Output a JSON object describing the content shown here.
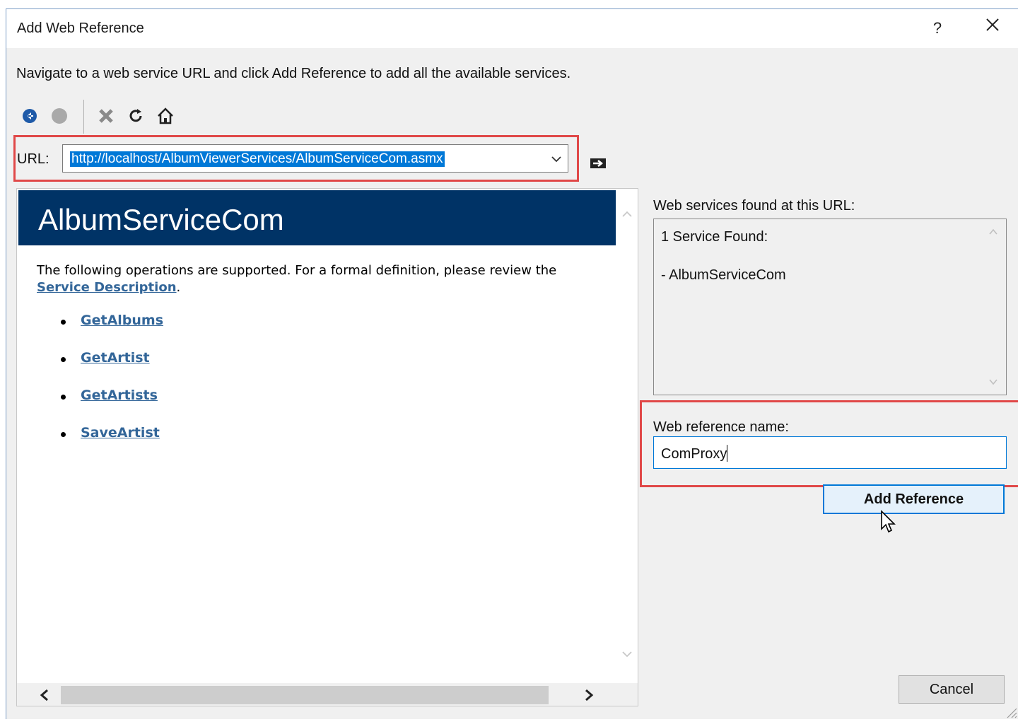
{
  "window": {
    "title": "Add Web Reference",
    "help_label": "?",
    "instruction": "Navigate to a web service URL and click Add Reference to add all the available services."
  },
  "toolbar": {
    "icons": [
      "back-icon",
      "forward-icon",
      "stop-icon",
      "refresh-icon",
      "home-icon"
    ]
  },
  "url": {
    "label": "URL:",
    "value": "http://localhost/AlbumViewerServices/AlbumServiceCom.asmx"
  },
  "browser": {
    "service_title": "AlbumServiceCom",
    "desc_prefix": "The following operations are supported. For a formal definition, please review the",
    "desc_link": "Service Description",
    "desc_suffix": ".",
    "operations": [
      "GetAlbums",
      "GetArtist",
      "GetArtists",
      "SaveArtist"
    ]
  },
  "found": {
    "label": "Web services found at this URL:",
    "count_text": "1 Service Found:",
    "service_item": "- AlbumServiceCom"
  },
  "reference": {
    "label": "Web reference name:",
    "value": "ComProxy"
  },
  "buttons": {
    "add_reference": "Add Reference",
    "cancel": "Cancel"
  },
  "colors": {
    "accent": "#0078d7",
    "highlight_border": "#e04848",
    "service_header": "#003366",
    "link": "#336699"
  }
}
